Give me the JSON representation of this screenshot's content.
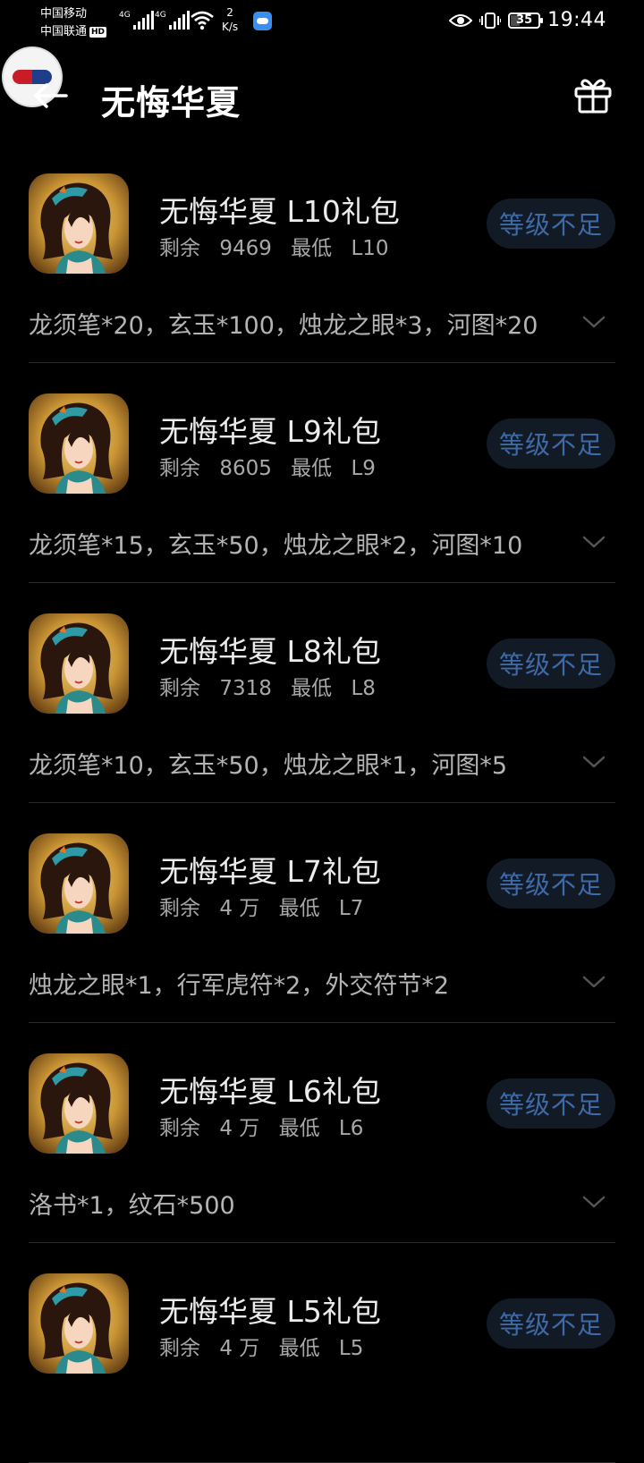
{
  "status_bar": {
    "carrier1": "中国移动",
    "carrier2": "中国联通",
    "hd_label": "HD",
    "net1": "4G",
    "net2": "4G",
    "speed_value": "2",
    "speed_unit": "K/s",
    "battery": "35",
    "time": "19:44"
  },
  "header": {
    "title": "无悔华夏"
  },
  "gifts": [
    {
      "title": "无悔华夏 L10礼包",
      "remain_label": "剩余",
      "remain": "9469",
      "min_label": "最低",
      "min": "L10",
      "button": "等级不足",
      "desc": "龙须笔*20，玄玉*100，烛龙之眼*3，河图*20"
    },
    {
      "title": "无悔华夏 L9礼包",
      "remain_label": "剩余",
      "remain": "8605",
      "min_label": "最低",
      "min": "L9",
      "button": "等级不足",
      "desc": "龙须笔*15，玄玉*50，烛龙之眼*2，河图*10"
    },
    {
      "title": "无悔华夏 L8礼包",
      "remain_label": "剩余",
      "remain": "7318",
      "min_label": "最低",
      "min": "L8",
      "button": "等级不足",
      "desc": "龙须笔*10，玄玉*50，烛龙之眼*1，河图*5"
    },
    {
      "title": "无悔华夏 L7礼包",
      "remain_label": "剩余",
      "remain": "4 万",
      "min_label": "最低",
      "min": "L7",
      "button": "等级不足",
      "desc": "烛龙之眼*1，行军虎符*2，外交符节*2"
    },
    {
      "title": "无悔华夏 L6礼包",
      "remain_label": "剩余",
      "remain": "4 万",
      "min_label": "最低",
      "min": "L6",
      "button": "等级不足",
      "desc": "洛书*1，纹石*500"
    },
    {
      "title": "无悔华夏 L5礼包",
      "remain_label": "剩余",
      "remain": "4 万",
      "min_label": "最低",
      "min": "L5",
      "button": "等级不足",
      "desc": ""
    }
  ]
}
